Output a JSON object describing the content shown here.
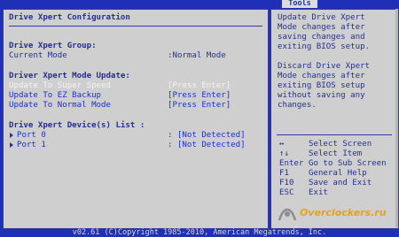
{
  "tabs": {
    "tools": "Tools"
  },
  "main": {
    "title": "Drive Xpert Configuration",
    "group_label": "Drive Xpert Group:",
    "current_mode_label": "Current Mode",
    "current_mode_value": ":Normal Mode",
    "update_label": "Driver Xpert Mode Update:",
    "options": [
      {
        "label": "Update To Super Speed",
        "value": "[Press Enter]"
      },
      {
        "label": "Update To EZ Backup",
        "value": "[Press Enter]"
      },
      {
        "label": "Update To Normal Mode",
        "value": "[Press Enter]"
      }
    ],
    "device_list_label": "Drive Xpert Device(s) List :",
    "ports": [
      {
        "label": "Port 0",
        "value": ": [Not Detected]"
      },
      {
        "label": "Port 1",
        "value": ": [Not Detected]"
      }
    ]
  },
  "help": {
    "line1": "Update Drive Xpert",
    "line2": "Mode changes after",
    "line3": "saving changes and",
    "line4": "exiting BIOS setup.",
    "line5": "Discard Drive Xpert",
    "line6": "Mode changes after",
    "line7": "exiting BIOS setup",
    "line8": "without saving any",
    "line9": "changes.",
    "keys": [
      {
        "key": "↔",
        "action": "Select Screen"
      },
      {
        "key": "↑↓",
        "action": "Select Item"
      },
      {
        "key": "Enter",
        "action": "Go to Sub Screen"
      },
      {
        "key": "F1",
        "action": "General Help"
      },
      {
        "key": "F10",
        "action": "Save and Exit"
      },
      {
        "key": "ESC",
        "action": "Exit"
      }
    ]
  },
  "watermark": "Overclockers.ru",
  "footer": "v02.61 (C)Copyright 1985-2010, American Megatrends, Inc.",
  "colors": {
    "background": "#1f2fb6",
    "panel": "#cfcfcf",
    "highlight": "#f4f4f4",
    "text": "#1e2a8e"
  }
}
